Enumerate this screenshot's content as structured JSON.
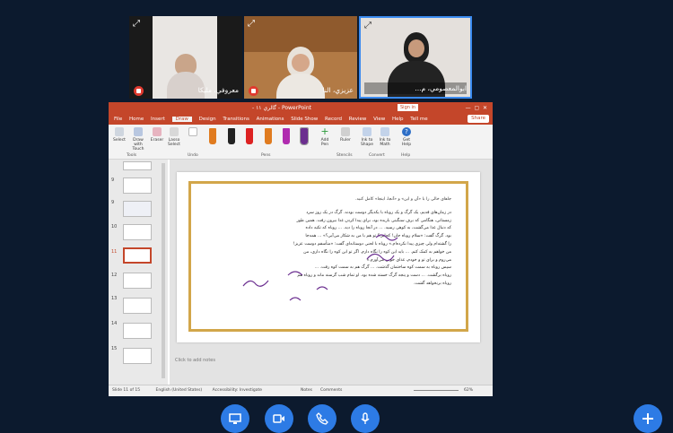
{
  "participants": [
    {
      "name": "معروفي، مليكا"
    },
    {
      "name": "عزيزي، النا"
    },
    {
      "name": "ابوالمعصومي، م..."
    }
  ],
  "powerpoint": {
    "title": "- گالري ۱۱ - PowerPoint",
    "signin": "Sign in",
    "tabs": [
      "File",
      "Home",
      "Insert",
      "Draw",
      "Design",
      "Transitions",
      "Animations",
      "Slide Show",
      "Record",
      "Review",
      "View",
      "Help",
      "Tell me"
    ],
    "share": "Share",
    "ribbon_groups": [
      "Tools",
      "Undo",
      "Pens",
      "Stencils",
      "Convert",
      "Help"
    ],
    "tools": [
      "Select",
      "Draw with Touch",
      "Eraser",
      "Lasso Select"
    ],
    "other_tools": [
      "Add Pen",
      "Ruler",
      "Ink to Shape",
      "Ink to Math",
      "Ink Replay"
    ],
    "help_label": "Get Help",
    "slide_numbers": [
      "9",
      "10",
      "11",
      "12",
      "13",
      "14",
      "15"
    ],
    "active_slide": "11",
    "notes_placeholder": "Click to add notes",
    "status_left": "Slide 11 of 15",
    "status_lang": "English (United States)",
    "status_access": "Accessibility: Investigate",
    "status_notes": "Notes",
    "status_comments": "Comments",
    "zoom": "62%"
  },
  "slide_text": {
    "heading": "جاهای خالی را با «آن و این» و «آنجا، اینجا» کامل کنید.",
    "lines": [
      "در زمان‌های قدیم، یک گرگ و یک روباه با یکدیگر دوست بودند. گرگ در یک روز سرد",
      "زمستانی، هنگامی که برف سنگینی باریده بود، برای پیدا کردن غذا بیرون رفت. همین طور",
      "که دنبال غذا می‌گشت، به کوهی رسید. ... در آنجا روباه را دید. ... روباه که تکیه داده",
      "بود. گرگ گفت: «سلام روباه جان! کجایی؟ تو هم با من به شکار می‌آیی؟» ... همه‌جا",
      "را گشته‌ام ولی چیزی پیدا نکرده‌ام.» روباه با لحنی دوستانه‌ای گفت: «متأسفم دوست عزیز!",
      "من خواهم به کمک کنم. ... باید این کوه را نگاه دارم. اگر تو این کوه را نگاه داری، من",
      "می‌روم و برای تو و خودم، غذای خوبی می‌آورم.»",
      "سپس روباه به سمت کوه ساختمان گذشت. ... گرگ هم به سمت کوه رفت. ...",
      "روباه برگشت. ... دست و پنجه گرگ خسته شده بود. او تمام شب گرسنه ماند و روباه هم",
      "روباه برنخواهد گشت."
    ]
  }
}
